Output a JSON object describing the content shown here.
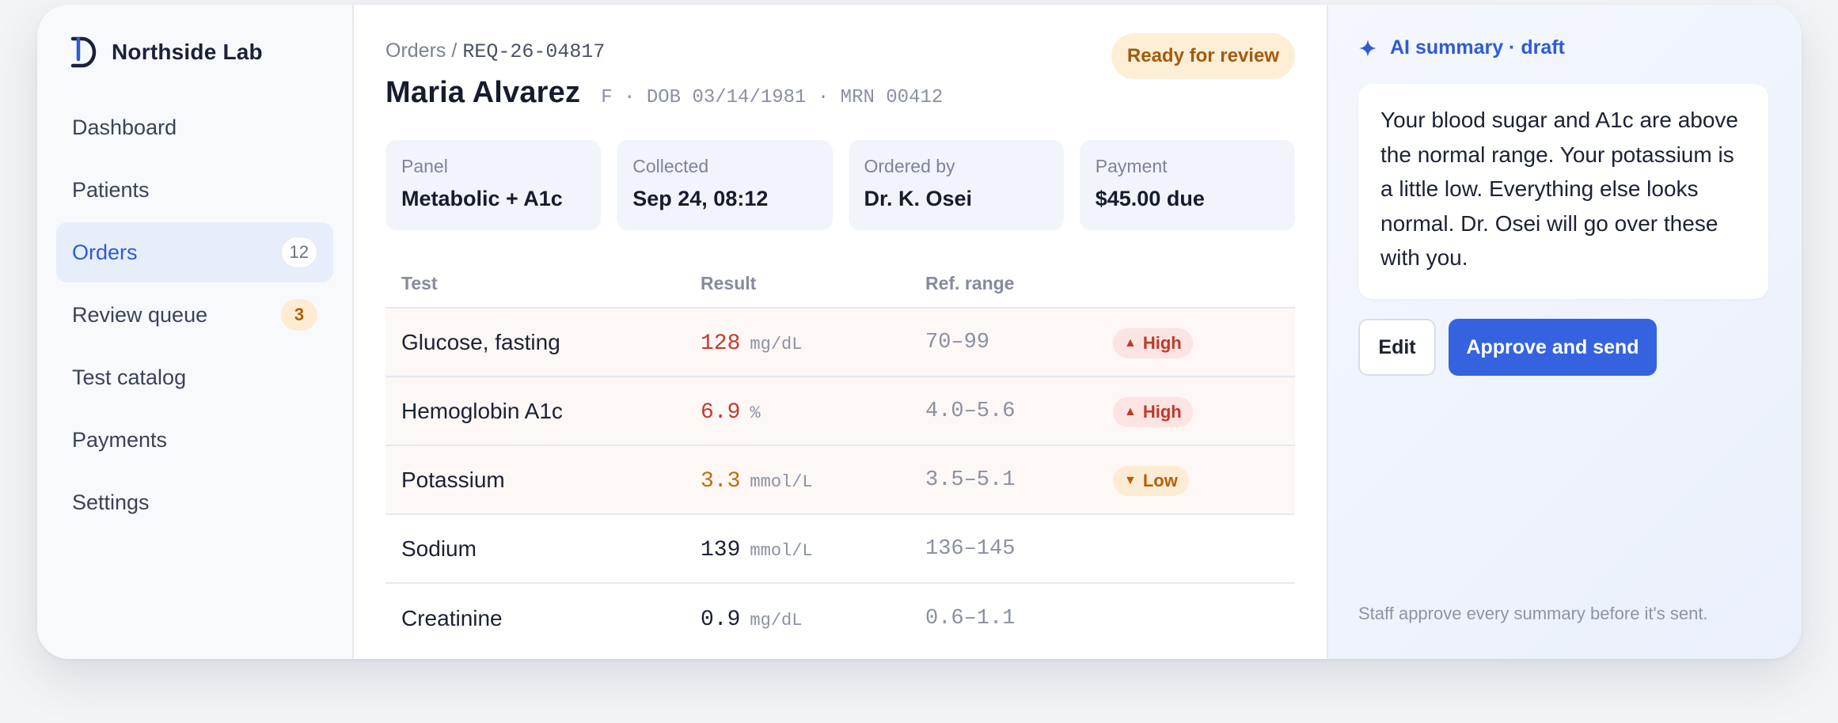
{
  "brand": {
    "name": "Northside Lab",
    "logo_icon": "northside-logo-icon"
  },
  "sidebar": {
    "items": [
      {
        "label": "Dashboard",
        "active": false,
        "badge": ""
      },
      {
        "label": "Patients",
        "active": false,
        "badge": ""
      },
      {
        "label": "Orders",
        "active": true,
        "badge": "12",
        "badge_style": "count"
      },
      {
        "label": "Review queue",
        "active": false,
        "badge": "3",
        "badge_style": "alert"
      },
      {
        "label": "Test catalog",
        "active": false,
        "badge": ""
      },
      {
        "label": "Payments",
        "active": false,
        "badge": ""
      },
      {
        "label": "Settings",
        "active": false,
        "badge": ""
      }
    ]
  },
  "header": {
    "breadcrumb_root": "Orders",
    "breadcrumb_sep": "/",
    "order_id": "REQ-26-04817",
    "patient_name": "Maria Alvarez",
    "patient_meta": "F · DOB 03/14/1981 · MRN 00412",
    "status": "Ready for review"
  },
  "info_cards": [
    {
      "label": "Panel",
      "value": "Metabolic + A1c"
    },
    {
      "label": "Collected",
      "value": "Sep 24, 08:12"
    },
    {
      "label": "Ordered by",
      "value": "Dr. K. Osei"
    },
    {
      "label": "Payment",
      "value": "$45.00 due"
    }
  ],
  "results": {
    "columns": {
      "test": "Test",
      "result": "Result",
      "range": "Ref. range",
      "flag": ""
    },
    "rows": [
      {
        "test": "Glucose, fasting",
        "value": "128",
        "unit": "mg/dL",
        "range": "70–99",
        "flag": "High",
        "flag_type": "high"
      },
      {
        "test": "Hemoglobin A1c",
        "value": "6.9",
        "unit": "%",
        "range": "4.0–5.6",
        "flag": "High",
        "flag_type": "high"
      },
      {
        "test": "Potassium",
        "value": "3.3",
        "unit": "mmol/L",
        "range": "3.5–5.1",
        "flag": "Low",
        "flag_type": "low"
      },
      {
        "test": "Sodium",
        "value": "139",
        "unit": "mmol/L",
        "range": "136–145",
        "flag": "",
        "flag_type": "normal"
      },
      {
        "test": "Creatinine",
        "value": "0.9",
        "unit": "mg/dL",
        "range": "0.6–1.1",
        "flag": "",
        "flag_type": "normal"
      }
    ]
  },
  "ai": {
    "title": "AI summary · draft",
    "summary": "Your blood sugar and A1c are above the normal range. Your potassium is a little low. Everything else looks normal. Dr. Osei will go over these with you.",
    "edit_label": "Edit",
    "approve_label": "Approve and send",
    "footnote": "Staff approve every summary before it's sent."
  },
  "colors": {
    "accent": "#3563e0",
    "high": "#c43a2c",
    "low": "#c26d0d",
    "status_bg": "#fdeed6"
  }
}
